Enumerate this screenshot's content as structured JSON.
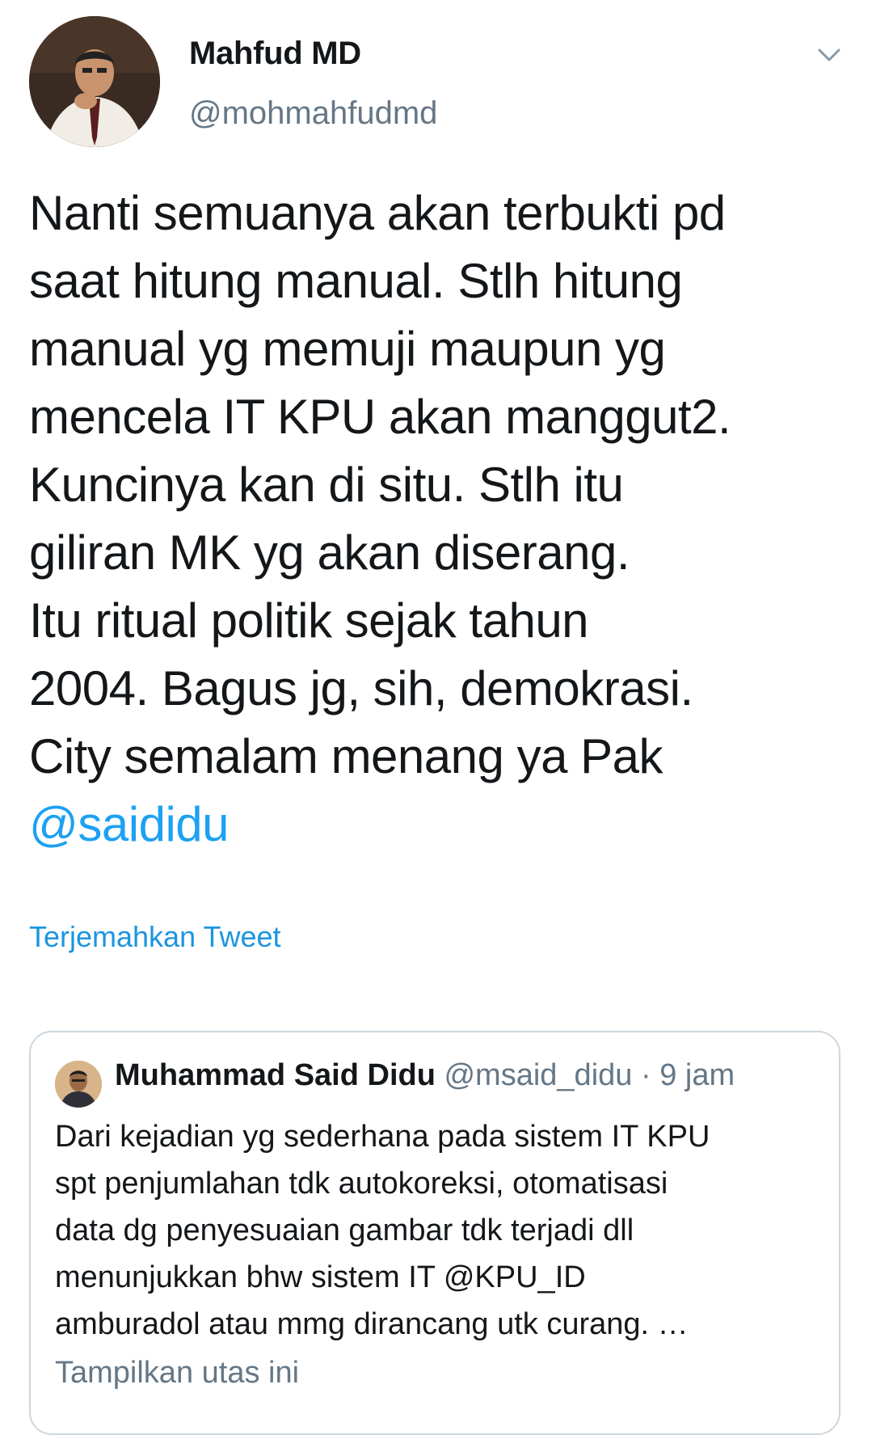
{
  "tweet": {
    "author": {
      "display_name": "Mahfud MD",
      "handle": "@mohmahfudmd"
    },
    "text_lines": [
      "Nanti semuanya akan terbukti pd",
      "saat hitung manual. Stlh hitung",
      "manual yg memuji maupun yg",
      "mencela IT KPU akan manggut2.",
      "Kuncinya kan di situ. Stlh itu",
      "giliran MK yg akan diserang.",
      "Itu ritual politik sejak tahun",
      "2004. Bagus jg, sih, demokrasi.",
      "City semalam menang ya Pak"
    ],
    "mention": "@saididu",
    "translate_label": "Terjemahkan Tweet",
    "menu_icon": "chevron-down-icon"
  },
  "quoted_tweet": {
    "display_name": "Muhammad Said Didu",
    "handle": "@msaid_didu",
    "separator": "·",
    "time": "9 jam",
    "text_lines": [
      "Dari kejadian yg sederhana pada sistem IT KPU",
      "spt penjumlahan tdk autokoreksi, otomatisasi",
      "data dg penyesuaian gambar tdk terjadi dll",
      "menunjukkan bhw sistem IT @KPU_ID",
      "amburadol atau mmg dirancang utk curang. …"
    ],
    "show_thread_label": "Tampilkan utas ini"
  },
  "colors": {
    "link": "#1da1f2",
    "secondary_text": "#657786",
    "border": "#ccd6dd"
  }
}
